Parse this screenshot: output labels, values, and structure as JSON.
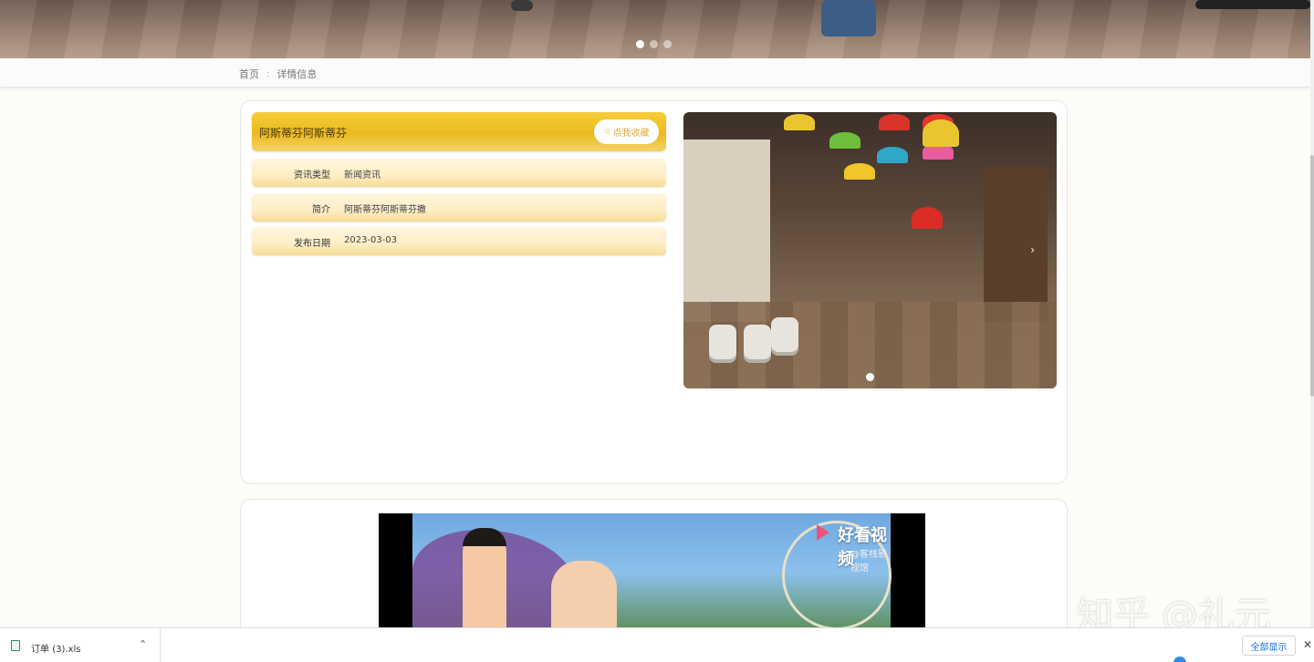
{
  "hero": {
    "slides": 3,
    "active_slide": 1
  },
  "breadcrumb": {
    "home": "首页",
    "separator": ":",
    "current": "详情信息"
  },
  "detail": {
    "title": "阿斯蒂芬阿斯蒂芬",
    "favorite_label": "点我收藏",
    "favorite_icon": "star-outline-icon",
    "fields": [
      {
        "label": "资讯类型",
        "value": "新闻资讯"
      },
      {
        "label": "简介",
        "value": "阿斯蒂芬阿斯蒂芬撒"
      },
      {
        "label": "发布日期",
        "value": "2023-03-03"
      }
    ]
  },
  "photo_carousel": {
    "slides": 1,
    "active_slide": 1
  },
  "video": {
    "brand": "好看视频",
    "channel": "@客栈影视馆"
  },
  "watermark": "知乎 @礼元",
  "download_bar": {
    "file_name": "订单 (3).xls",
    "show_all_label": "全部显示"
  },
  "colors": {
    "accent_gold": "#ebba1f",
    "row_bg": "#fdeec6",
    "link_blue": "#1a6fd6"
  }
}
